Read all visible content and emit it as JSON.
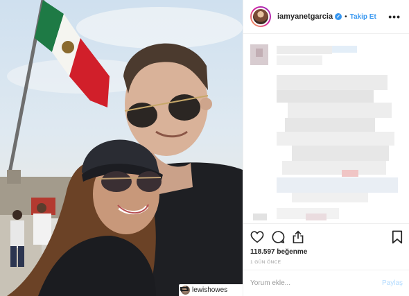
{
  "post": {
    "username": "iamyanetgarcia",
    "follow_label": "Takip Et",
    "more_label": "•••",
    "separator": "•",
    "likes_text": "118.597 beğenme",
    "time_ago": "1 GÜN ÖNCE",
    "verified_mark": "✓"
  },
  "comment": {
    "placeholder": "Yorum ekle...",
    "post_label": "Paylaş"
  },
  "photo": {
    "repost_username": "lewishowes"
  },
  "colors": {
    "accent": "#3897f0",
    "post_disabled": "#b3dbff",
    "flag_green": "#1e7a45",
    "flag_red": "#d11f2a"
  },
  "icons": [
    "heart-icon",
    "comment-icon",
    "share-icon",
    "bookmark-icon",
    "more-icon",
    "verified-icon",
    "repost-icon"
  ]
}
